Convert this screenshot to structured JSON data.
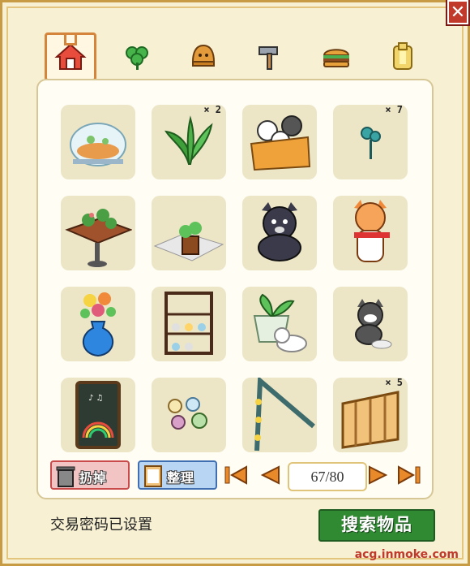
{
  "window": {
    "close_symbol": "✕"
  },
  "tabs": [
    {
      "name": "house-icon",
      "active": true
    },
    {
      "name": "clover-icon",
      "active": false
    },
    {
      "name": "bell-icon",
      "active": false
    },
    {
      "name": "hammer-icon",
      "active": false
    },
    {
      "name": "burger-icon",
      "active": false
    },
    {
      "name": "scroll-icon",
      "active": false
    }
  ],
  "items": [
    {
      "name": "glass-dome-diorama",
      "qty": ""
    },
    {
      "name": "green-leaf-plant",
      "qty": "× 2"
    },
    {
      "name": "cats-in-box",
      "qty": ""
    },
    {
      "name": "small-sprout",
      "qty": "× 7"
    },
    {
      "name": "plant-table",
      "qty": ""
    },
    {
      "name": "potted-plant-rug",
      "qty": ""
    },
    {
      "name": "black-cat-plush",
      "qty": ""
    },
    {
      "name": "orange-cat-scarf",
      "qty": ""
    },
    {
      "name": "flower-vase",
      "qty": ""
    },
    {
      "name": "teacup-rack",
      "qty": ""
    },
    {
      "name": "white-cat-plant-pot",
      "qty": ""
    },
    {
      "name": "gray-kitten",
      "qty": ""
    },
    {
      "name": "chalkboard-sign",
      "qty": ""
    },
    {
      "name": "dessert-plates",
      "qty": ""
    },
    {
      "name": "flower-vine-arch",
      "qty": ""
    },
    {
      "name": "wooden-gate",
      "qty": "× 5"
    }
  ],
  "actions": {
    "discard_label": "扔掉",
    "sort_label": "整理"
  },
  "pager": {
    "current": "67",
    "total": "80",
    "display": "67/80"
  },
  "status_text": "交易密码已设置",
  "search_button": "搜索物品",
  "watermark": "acg.inmoke.com"
}
